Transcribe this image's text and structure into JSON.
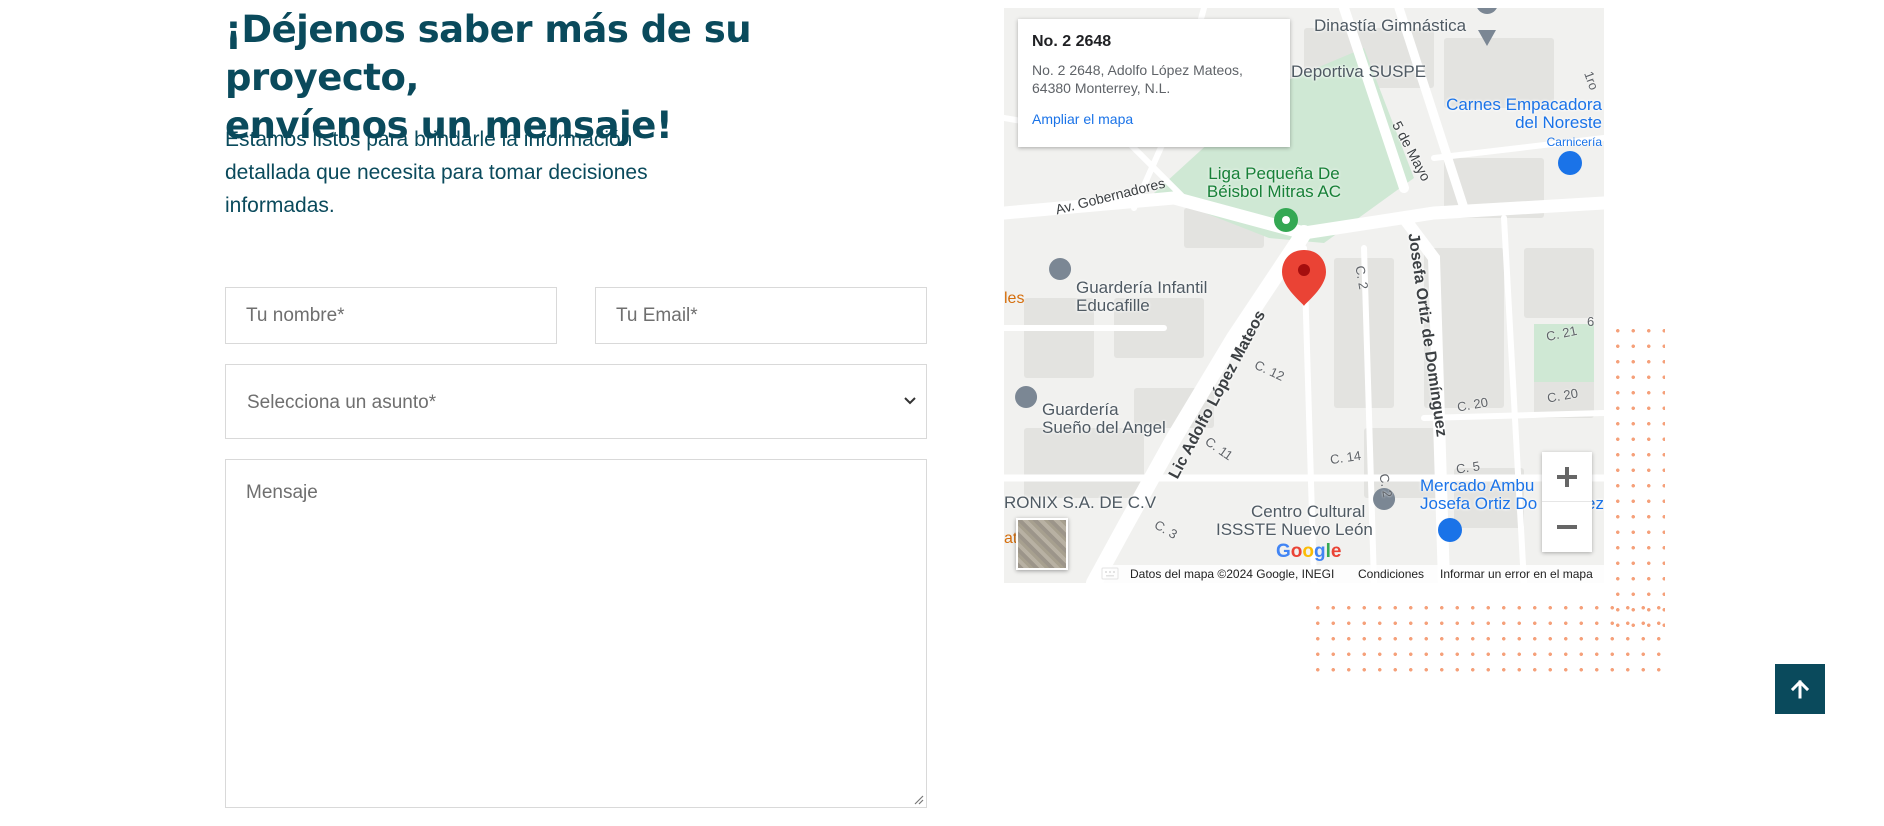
{
  "heading": {
    "line1": "¡Déjenos saber más de su proyecto,",
    "line2": "envíenos un mensaje!"
  },
  "intro": "Estamos listos para brindarle la información detallada que necesita para tomar decisiones informadas.",
  "form": {
    "name_placeholder": "Tu nombre*",
    "email_placeholder": "Tu Email*",
    "subject_selected": "Selecciona un asunto*",
    "message_placeholder": "Mensaje"
  },
  "map": {
    "card_title": "No. 2 2648",
    "card_address": "No. 2 2648, Adolfo López Mateos, 64380 Monterrey, N.L.",
    "card_link": "Ampliar el mapa",
    "labels": {
      "dinastia": "Dinastía Gimnástica",
      "suspe": "Deportiva SUSPE",
      "carnes1": "Carnes Empacadora",
      "carnes2": "del Noreste",
      "carniceria": "Carnicería",
      "liga1": "Liga Pequeña De",
      "liga2": "Béisbol Mitras AC",
      "gobernadores": "Av. Gobernadores",
      "cinco_mayo": "5 de Mayo",
      "josefa": "Josefa Ortiz de Domínguez",
      "guarderia_inf1": "Guardería Infantil",
      "guarderia_inf2": "Educafille",
      "les": "les",
      "c2": "C. 2",
      "c21": "C. 21",
      "c6": "6",
      "c12": "C. 12",
      "c20a": "C. 20",
      "c20b": "C. 20",
      "lopez_mateos": "Lic Adolfo López Mateos",
      "guarderia_angel1": "Guardería",
      "guarderia_angel2": "Sueño del Angel",
      "c11": "C. 11",
      "c14": "C. 14",
      "c2b": "C. 2",
      "c5": "C. 5",
      "mercado1": "Mercado Ambu",
      "mercado2": "Josefa Ortiz Do",
      "ez": "ez",
      "ronix": "RONIX S.A. DE C.V",
      "c3": "C. 3",
      "cultural1": "Centro Cultural",
      "cultural2": "ISSSTE Nuevo León",
      "at": "at",
      "one": "1ro"
    },
    "google_logo": "Google",
    "attribution": {
      "data": "Datos del mapa ©2024 Google, INEGI",
      "terms": "Condiciones",
      "report": "Informar un error en el mapa"
    }
  },
  "colors": {
    "brand": "#0a4a5c",
    "accent_dots": "#f5a07a",
    "map_link": "#1a73e8",
    "pin_red": "#ea4335",
    "park": "#c8e6c9"
  },
  "icons": {
    "subject_chevron": "chevron-down-icon",
    "scroll_top": "arrow-up-icon",
    "zoom_in": "plus-icon",
    "zoom_out": "minus-icon",
    "keyboard": "keyboard-icon"
  }
}
